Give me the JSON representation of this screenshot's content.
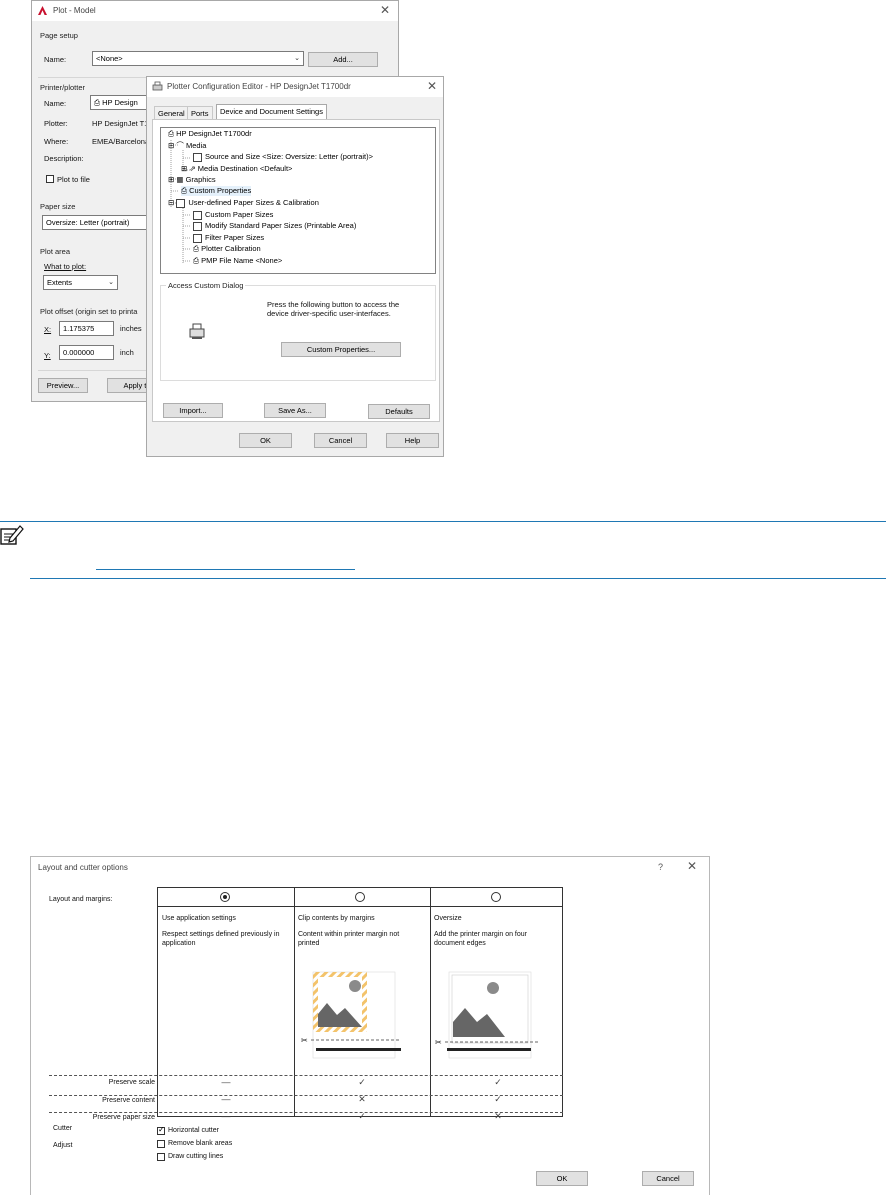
{
  "plot_model": {
    "title": "Plot - Model",
    "page_setup": {
      "group": "Page setup",
      "name_label": "Name:",
      "name_value": "<None>",
      "add_button": "Add..."
    },
    "printer": {
      "group": "Printer/plotter",
      "name_label": "Name:",
      "name_value": "HP Design",
      "plotter_label": "Plotter:",
      "plotter_value": "HP DesignJet T1",
      "where_label": "Where:",
      "where_value": "EMEA/Barcelona",
      "description_label": "Description:",
      "plot_to_file": "Plot to file"
    },
    "paper_size": {
      "group": "Paper size",
      "value": "Oversize: Letter (portrait)"
    },
    "plot_area": {
      "group": "Plot area",
      "what_label": "What to plot:",
      "what_value": "Extents"
    },
    "plot_offset": {
      "group": "Plot offset (origin set to printa",
      "x_label": "X:",
      "x_value": "1.175375",
      "x_unit": "inches",
      "y_label": "Y:",
      "y_value": "0.000000",
      "y_unit": "inch"
    },
    "preview_button": "Preview...",
    "apply_button": "Apply to"
  },
  "plotter_editor": {
    "title": "Plotter Configuration Editor - HP DesignJet T1700dr",
    "tabs": [
      "General",
      "Ports",
      "Device and Document Settings"
    ],
    "tree": {
      "root": "HP DesignJet T1700dr",
      "media": "Media",
      "source_size": "Source and Size <Size: Oversize: Letter (portrait)>",
      "media_destination": "Media Destination <Default>",
      "graphics": "Graphics",
      "custom_properties": "Custom Properties",
      "user_defined": "User-defined Paper Sizes & Calibration",
      "custom_paper_sizes": "Custom Paper Sizes",
      "modify_standard": "Modify Standard Paper Sizes (Printable Area)",
      "filter_paper": "Filter Paper Sizes",
      "plotter_calibration": "Plotter Calibration",
      "pmp_file": "PMP File Name <None>"
    },
    "access_group": "Access Custom Dialog",
    "access_text_1": "Press the following button to access the",
    "access_text_2": "device driver-specific user-interfaces.",
    "custom_properties_button": "Custom Properties...",
    "import_button": "Import...",
    "save_as_button": "Save As...",
    "defaults_button": "Defaults",
    "ok_button": "OK",
    "cancel_button": "Cancel",
    "help_button": "Help"
  },
  "layout_dialog": {
    "title": "Layout and cutter options",
    "help_glyph": "?",
    "row_layout_label": "Layout and margins:",
    "columns": [
      {
        "heading": "Use application settings",
        "desc": "Respect settings defined previously in application",
        "selected": true
      },
      {
        "heading": "Clip contents by margins",
        "desc": "Content within printer margin not printed",
        "selected": false
      },
      {
        "heading": "Oversize",
        "desc": "Add the printer margin on four document edges",
        "selected": false
      }
    ],
    "rows": [
      {
        "label": "Preserve scale",
        "values": [
          "—",
          "✓",
          "✓"
        ]
      },
      {
        "label": "Preserve content",
        "values": [
          "—",
          "✕",
          "✓"
        ]
      },
      {
        "label": "Preserve paper size",
        "values": [
          "—",
          "✓",
          "✕"
        ]
      }
    ],
    "cutter_label": "Cutter",
    "adjust_label": "Adjust",
    "horizontal_cutter": "Horizontal cutter",
    "horizontal_cutter_checked": true,
    "remove_blank": "Remove blank areas",
    "remove_blank_checked": false,
    "draw_cutting": "Draw cutting lines",
    "draw_cutting_checked": false,
    "ok_button": "OK",
    "cancel_button": "Cancel"
  },
  "colors": {
    "note_blue": "#1f78b4",
    "hatch_yellow": "#f3c36b",
    "image_gray": "#666666"
  }
}
